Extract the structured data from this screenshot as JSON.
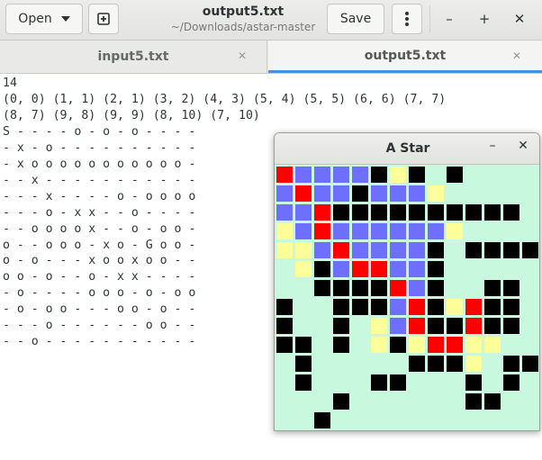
{
  "toolbar": {
    "open_label": "Open",
    "save_label": "Save"
  },
  "window": {
    "title": "output5.txt",
    "subtitle": "~/Downloads/astar-master"
  },
  "tabs": [
    {
      "label": "input5.txt"
    },
    {
      "label": "output5.txt",
      "active": true
    }
  ],
  "editor": {
    "lines": [
      "14",
      "(0, 0) (1, 1) (2, 1) (3, 2) (4, 3) (5, 4) (5, 5) (6, 6) (7, 7)",
      "(8, 7) (9, 8) (9, 9) (8, 10) (7, 10)",
      "S - - - - o - o - o - - - -",
      "- x - o - - - - - - - - - -",
      "- x o o o o o o o o o o o -",
      "- - x - - - - - - - - - - -",
      "- - - x - - - - o - o o o o",
      "- - - o - x x - - o - - - -",
      "- - o o o o x - - o - o o -",
      "o - - o o o - x o - G o o -",
      "o - o - - - x o o x o o - -",
      "o o - o - - o - x x - - - -",
      "- o - - - - o o o - o - o o",
      "- o - o o - - - o o - o - -",
      "- - - o - - - - - - o o - -",
      "- - o - - - - - - - - - - -"
    ]
  },
  "dialog": {
    "title": "A Star"
  },
  "colors": {
    "black": "#000000",
    "red": "#ff0000",
    "blue": "#6f6fff",
    "yellow": "#ffff99",
    "empty": "#c8f8de"
  },
  "grid": {
    "legend": {
      "k": "wall",
      "r": "path",
      "b": "explored",
      "y": "frontier",
      ".": "empty"
    },
    "rows": [
      "rbbbbkyk.k....",
      "brbbkbbby.....",
      "bbrkkkkkkkkkk.",
      "ybrbbbbbby....",
      "yybrbbbbk.kkkk",
      ".ykbrrbbk.....",
      "..kkkkrbk..kk.",
      "k..kkkbrkyrkk.",
      "k..k.ybrkkrkk.",
      "kk.k.ykyrryy..",
      ".k.....kkky.kk",
      ".k...kk...k.k.",
      "...k......kk..",
      "..k..........."
    ]
  }
}
